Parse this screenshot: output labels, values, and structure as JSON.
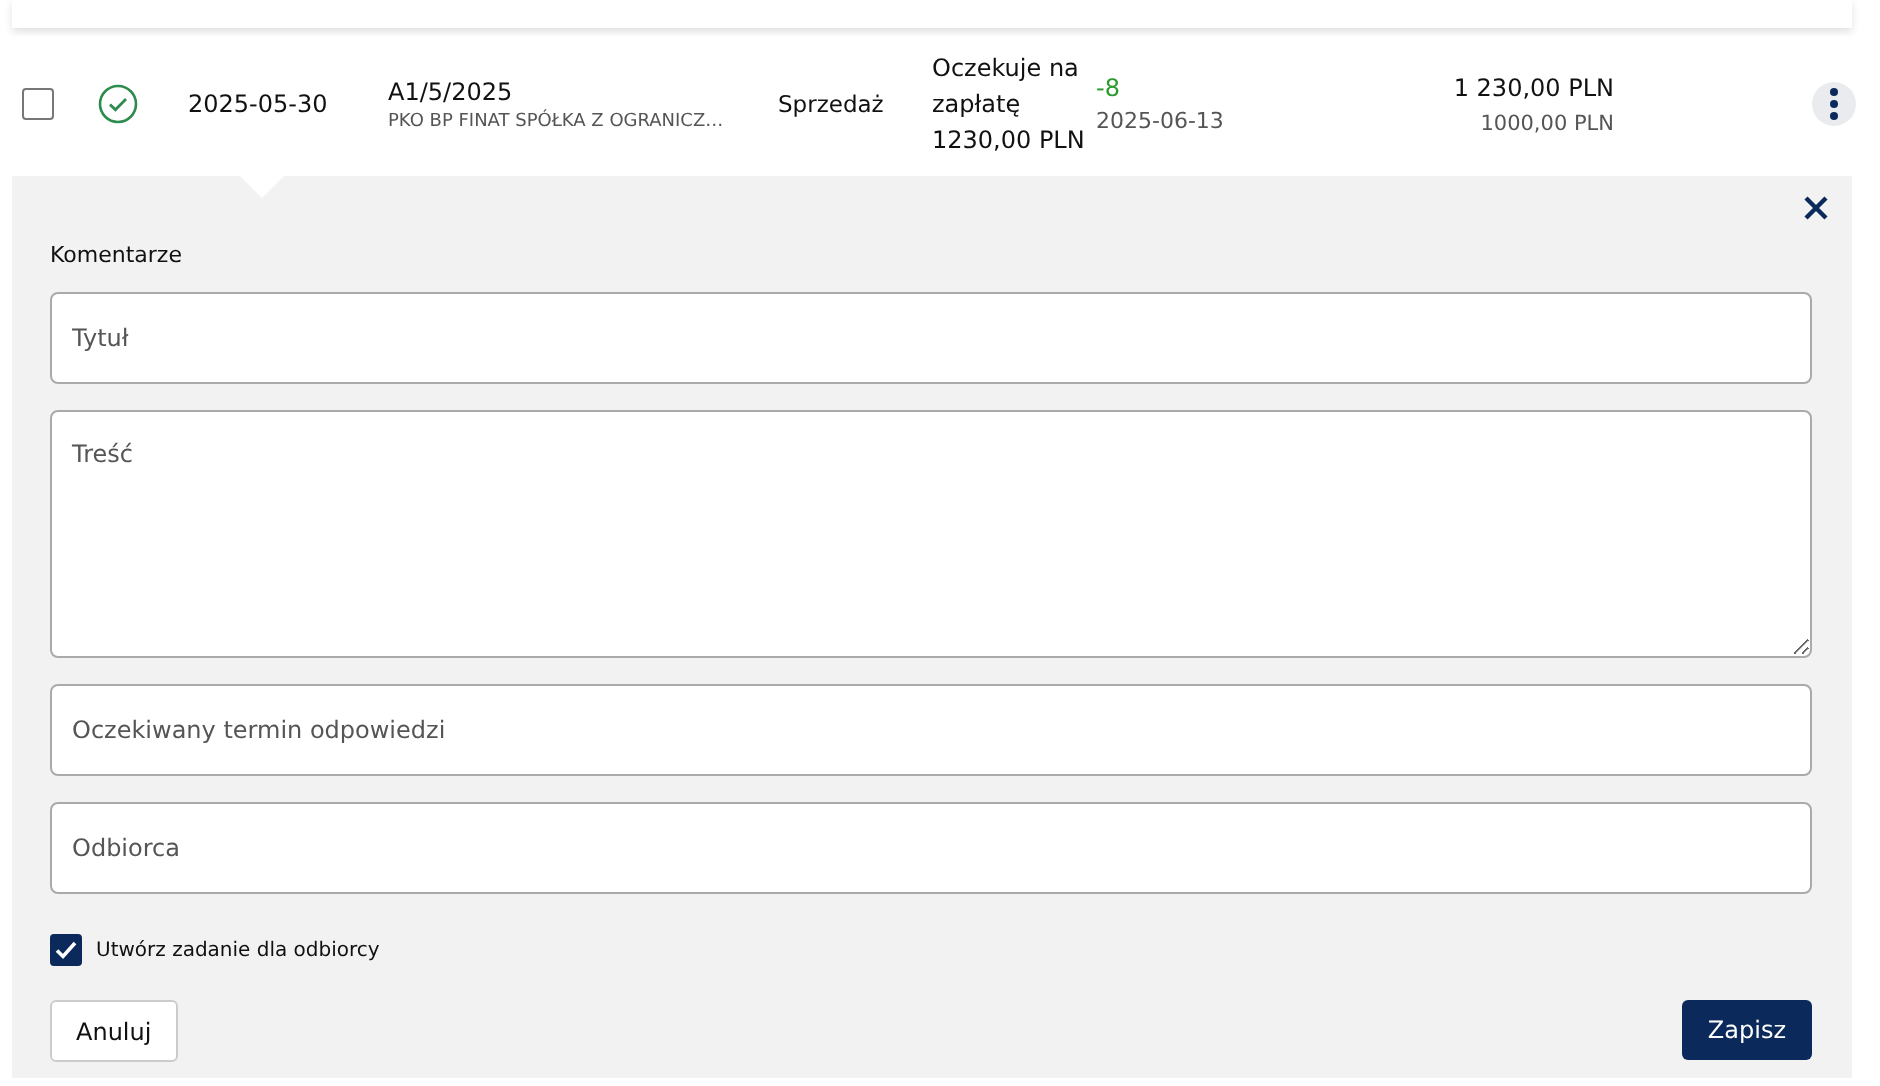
{
  "row": {
    "checked": false,
    "paid": true,
    "date": "2025-05-30",
    "number": "A1/5/2025",
    "contractor": "PKO BP FINAT SPÓŁKA Z OGRANICZ…",
    "type": "Sprzedaż",
    "payment_status": "Oczekuje na zapłatę 1230,00 PLN",
    "days": "-8",
    "due_date": "2025-06-13",
    "gross": "1 230,00 PLN",
    "net": "1000,00 PLN"
  },
  "comments": {
    "title": "Komentarze",
    "fields": [
      {
        "kind": "input",
        "placeholder": "Tytuł"
      },
      {
        "kind": "textarea",
        "placeholder": "Treść"
      },
      {
        "kind": "input",
        "placeholder": "Oczekiwany termin odpowiedzi"
      },
      {
        "kind": "input",
        "placeholder": "Odbiorca"
      }
    ],
    "task_checkbox": {
      "label": "Utwórz zadanie dla odbiorcy",
      "checked": true
    },
    "cancel": "Anuluj",
    "save": "Zapisz"
  }
}
